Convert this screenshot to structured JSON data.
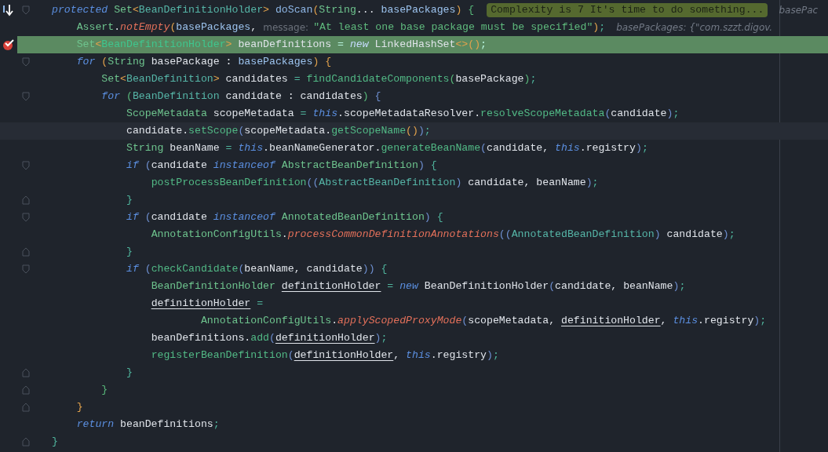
{
  "editor": {
    "lines": [
      {
        "step_marker": true,
        "fold_start": true,
        "segments": [
          {
            "kind": "code",
            "tokens": [
              {
                "text": "protected ",
                "kind": "kw"
              },
              {
                "text": "Set",
                "kind": "type"
              },
              {
                "text": "<",
                "kind": "p1"
              },
              {
                "text": "BeanDefinitionHolder",
                "kind": "gen"
              },
              {
                "text": "> ",
                "kind": "p1"
              },
              {
                "text": "doScan",
                "kind": "decl"
              },
              {
                "text": "(",
                "kind": "p1"
              },
              {
                "text": "String",
                "kind": "type"
              },
              {
                "text": "... ",
                "kind": "id"
              },
              {
                "text": "basePackages",
                "kind": "param"
              },
              {
                "text": ")",
                "kind": "p1"
              },
              {
                "text": " {",
                "kind": "p2"
              }
            ]
          },
          {
            "kind": "badge",
            "text": "Complexity is 7 It's time to do something..."
          },
          {
            "kind": "value_hint",
            "text": "basePac"
          }
        ]
      },
      {
        "segments": [
          {
            "kind": "code",
            "tokens": [
              {
                "text": "    Assert",
                "kind": "type"
              },
              {
                "text": ".",
                "kind": "id"
              },
              {
                "text": "notEmpty",
                "kind": "sfn"
              },
              {
                "text": "(",
                "kind": "p1"
              },
              {
                "text": "basePackages",
                "kind": "param"
              },
              {
                "text": ",",
                "kind": "id"
              }
            ]
          },
          {
            "kind": "param_hint",
            "text": "message:"
          },
          {
            "kind": "code",
            "tokens": [
              {
                "text": "\"At least one base package must be specified\"",
                "kind": "str"
              },
              {
                "text": ")",
                "kind": "p1"
              },
              {
                "text": ";",
                "kind": "op"
              }
            ]
          },
          {
            "kind": "value_hint",
            "text": "basePackages: {\"com.szzt.digov."
          }
        ]
      },
      {
        "execution": true,
        "breakpoint": true,
        "segments": [
          {
            "kind": "code",
            "tokens": [
              {
                "text": "    Set",
                "kind": "type"
              },
              {
                "text": "<",
                "kind": "p1"
              },
              {
                "text": "BeanDefinitionHolder",
                "kind": "gen"
              },
              {
                "text": ">",
                "kind": "p1"
              },
              {
                "text": " beanDefinitions ",
                "kind": "id"
              },
              {
                "text": "= ",
                "kind": "op"
              },
              {
                "text": "new",
                "kind": "kw"
              },
              {
                "text": " LinkedHashSet",
                "kind": "id"
              },
              {
                "text": "<>",
                "kind": "p1"
              },
              {
                "text": "()",
                "kind": "p1"
              },
              {
                "text": ";",
                "kind": "op"
              }
            ]
          }
        ]
      },
      {
        "fold_start": true,
        "segments": [
          {
            "kind": "code",
            "tokens": [
              {
                "text": "    for",
                "kind": "kw"
              },
              {
                "text": " (",
                "kind": "p1"
              },
              {
                "text": "String",
                "kind": "type"
              },
              {
                "text": " basePackage : ",
                "kind": "id"
              },
              {
                "text": "basePackages",
                "kind": "param"
              },
              {
                "text": ")",
                "kind": "p1"
              },
              {
                "text": " {",
                "kind": "p1"
              }
            ]
          }
        ]
      },
      {
        "segments": [
          {
            "kind": "code",
            "tokens": [
              {
                "text": "        Set",
                "kind": "type"
              },
              {
                "text": "<",
                "kind": "p1"
              },
              {
                "text": "BeanDefinition",
                "kind": "gen"
              },
              {
                "text": ">",
                "kind": "p1"
              },
              {
                "text": " candidates ",
                "kind": "id"
              },
              {
                "text": "= ",
                "kind": "op"
              },
              {
                "text": "findCandidateComponents",
                "kind": "fn"
              },
              {
                "text": "(",
                "kind": "p2"
              },
              {
                "text": "basePackage",
                "kind": "id"
              },
              {
                "text": ")",
                "kind": "p2"
              },
              {
                "text": ";",
                "kind": "op"
              }
            ]
          }
        ]
      },
      {
        "fold_start": true,
        "segments": [
          {
            "kind": "code",
            "tokens": [
              {
                "text": "        for",
                "kind": "kw"
              },
              {
                "text": " (",
                "kind": "p2"
              },
              {
                "text": "BeanDefinition",
                "kind": "gen"
              },
              {
                "text": " candidate : candidates",
                "kind": "id"
              },
              {
                "text": ")",
                "kind": "p2"
              },
              {
                "text": " {",
                "kind": "p3"
              }
            ]
          }
        ]
      },
      {
        "segments": [
          {
            "kind": "code",
            "tokens": [
              {
                "text": "            ScopeMetadata",
                "kind": "type"
              },
              {
                "text": " scopeMetadata ",
                "kind": "id"
              },
              {
                "text": "= ",
                "kind": "op"
              },
              {
                "text": "this",
                "kind": "kw"
              },
              {
                "text": ".scopeMetadataResolver.",
                "kind": "id"
              },
              {
                "text": "resolveScopeMetadata",
                "kind": "fn"
              },
              {
                "text": "(",
                "kind": "p3"
              },
              {
                "text": "candidate",
                "kind": "id"
              },
              {
                "text": ")",
                "kind": "p3"
              },
              {
                "text": ";",
                "kind": "op"
              }
            ]
          }
        ]
      },
      {
        "caret": true,
        "segments": [
          {
            "kind": "code",
            "tokens": [
              {
                "text": "            candidate.",
                "kind": "id"
              },
              {
                "text": "setScope",
                "kind": "fn"
              },
              {
                "text": "(",
                "kind": "p3"
              },
              {
                "text": "scopeMetadata.",
                "kind": "id"
              },
              {
                "text": "getScopeName",
                "kind": "fn"
              },
              {
                "text": "()",
                "kind": "p1"
              },
              {
                "text": ")",
                "kind": "p3"
              },
              {
                "text": ";",
                "kind": "op"
              }
            ]
          }
        ]
      },
      {
        "segments": [
          {
            "kind": "code",
            "tokens": [
              {
                "text": "            String",
                "kind": "type"
              },
              {
                "text": " beanName ",
                "kind": "id"
              },
              {
                "text": "= ",
                "kind": "op"
              },
              {
                "text": "this",
                "kind": "kw"
              },
              {
                "text": ".beanNameGenerator.",
                "kind": "id"
              },
              {
                "text": "generateBeanName",
                "kind": "fn"
              },
              {
                "text": "(",
                "kind": "p3"
              },
              {
                "text": "candidate, ",
                "kind": "id"
              },
              {
                "text": "this",
                "kind": "kw"
              },
              {
                "text": ".registry",
                "kind": "id"
              },
              {
                "text": ")",
                "kind": "p3"
              },
              {
                "text": ";",
                "kind": "op"
              }
            ]
          }
        ]
      },
      {
        "fold_start": true,
        "segments": [
          {
            "kind": "code",
            "tokens": [
              {
                "text": "            if",
                "kind": "kw"
              },
              {
                "text": " (",
                "kind": "p3"
              },
              {
                "text": "candidate ",
                "kind": "id"
              },
              {
                "text": "instanceof",
                "kind": "kw"
              },
              {
                "text": " AbstractBeanDefinition",
                "kind": "type"
              },
              {
                "text": ")",
                "kind": "p3"
              },
              {
                "text": " {",
                "kind": "op"
              }
            ]
          }
        ]
      },
      {
        "segments": [
          {
            "kind": "code",
            "tokens": [
              {
                "text": "                postProcessBeanDefinition",
                "kind": "fn"
              },
              {
                "text": "((",
                "kind": "p3"
              },
              {
                "text": "AbstractBeanDefinition",
                "kind": "gen"
              },
              {
                "text": ")",
                "kind": "p3"
              },
              {
                "text": " candidate, beanName",
                "kind": "id"
              },
              {
                "text": ")",
                "kind": "p3"
              },
              {
                "text": ";",
                "kind": "op"
              }
            ]
          }
        ]
      },
      {
        "fold_end": true,
        "segments": [
          {
            "kind": "code",
            "tokens": [
              {
                "text": "            }",
                "kind": "op"
              }
            ]
          }
        ]
      },
      {
        "fold_start": true,
        "segments": [
          {
            "kind": "code",
            "tokens": [
              {
                "text": "            if",
                "kind": "kw"
              },
              {
                "text": " (",
                "kind": "p3"
              },
              {
                "text": "candidate ",
                "kind": "id"
              },
              {
                "text": "instanceof",
                "kind": "kw"
              },
              {
                "text": " AnnotatedBeanDefinition",
                "kind": "type"
              },
              {
                "text": ")",
                "kind": "p3"
              },
              {
                "text": " {",
                "kind": "op"
              }
            ]
          }
        ]
      },
      {
        "segments": [
          {
            "kind": "code",
            "tokens": [
              {
                "text": "                AnnotationConfigUtils",
                "kind": "type"
              },
              {
                "text": ".",
                "kind": "id"
              },
              {
                "text": "processCommonDefinitionAnnotations",
                "kind": "sfn"
              },
              {
                "text": "((",
                "kind": "p3"
              },
              {
                "text": "AnnotatedBeanDefinition",
                "kind": "gen"
              },
              {
                "text": ")",
                "kind": "p3"
              },
              {
                "text": " candidate",
                "kind": "id"
              },
              {
                "text": ")",
                "kind": "p3"
              },
              {
                "text": ";",
                "kind": "op"
              }
            ]
          }
        ]
      },
      {
        "fold_end": true,
        "segments": [
          {
            "kind": "code",
            "tokens": [
              {
                "text": "            }",
                "kind": "op"
              }
            ]
          }
        ]
      },
      {
        "fold_start": true,
        "segments": [
          {
            "kind": "code",
            "tokens": [
              {
                "text": "            if",
                "kind": "kw"
              },
              {
                "text": " (",
                "kind": "p3"
              },
              {
                "text": "checkCandidate",
                "kind": "fn"
              },
              {
                "text": "(",
                "kind": "p3"
              },
              {
                "text": "beanName, candidate",
                "kind": "id"
              },
              {
                "text": "))",
                "kind": "p3"
              },
              {
                "text": " {",
                "kind": "op"
              }
            ]
          }
        ]
      },
      {
        "segments": [
          {
            "kind": "code",
            "tokens": [
              {
                "text": "                BeanDefinitionHolder ",
                "kind": "type"
              },
              {
                "text": "definitionHolder",
                "kind": "var"
              },
              {
                "text": " = ",
                "kind": "op"
              },
              {
                "text": "new",
                "kind": "kw"
              },
              {
                "text": " BeanDefinitionHolder",
                "kind": "id"
              },
              {
                "text": "(",
                "kind": "p3"
              },
              {
                "text": "candidate, beanName",
                "kind": "id"
              },
              {
                "text": ")",
                "kind": "p3"
              },
              {
                "text": ";",
                "kind": "op"
              }
            ]
          }
        ]
      },
      {
        "segments": [
          {
            "kind": "code",
            "tokens": [
              {
                "text": "                definitionHolder",
                "kind": "var"
              },
              {
                "text": " =",
                "kind": "op"
              }
            ]
          }
        ]
      },
      {
        "segments": [
          {
            "kind": "code",
            "tokens": [
              {
                "text": "                        AnnotationConfigUtils",
                "kind": "type"
              },
              {
                "text": ".",
                "kind": "id"
              },
              {
                "text": "applyScopedProxyMode",
                "kind": "sfn"
              },
              {
                "text": "(",
                "kind": "p3"
              },
              {
                "text": "scopeMetadata, ",
                "kind": "id"
              },
              {
                "text": "definitionHolder",
                "kind": "var"
              },
              {
                "text": ", ",
                "kind": "id"
              },
              {
                "text": "this",
                "kind": "kw"
              },
              {
                "text": ".registry",
                "kind": "id"
              },
              {
                "text": ")",
                "kind": "p3"
              },
              {
                "text": ";",
                "kind": "op"
              }
            ]
          }
        ]
      },
      {
        "segments": [
          {
            "kind": "code",
            "tokens": [
              {
                "text": "                beanDefinitions.",
                "kind": "id"
              },
              {
                "text": "add",
                "kind": "fn"
              },
              {
                "text": "(",
                "kind": "p3"
              },
              {
                "text": "definitionHolder",
                "kind": "var"
              },
              {
                "text": ")",
                "kind": "p3"
              },
              {
                "text": ";",
                "kind": "op"
              }
            ]
          }
        ]
      },
      {
        "segments": [
          {
            "kind": "code",
            "tokens": [
              {
                "text": "                registerBeanDefinition",
                "kind": "fn"
              },
              {
                "text": "(",
                "kind": "p3"
              },
              {
                "text": "definitionHolder",
                "kind": "var"
              },
              {
                "text": ", ",
                "kind": "id"
              },
              {
                "text": "this",
                "kind": "kw"
              },
              {
                "text": ".registry",
                "kind": "id"
              },
              {
                "text": ")",
                "kind": "p3"
              },
              {
                "text": ";",
                "kind": "op"
              }
            ]
          }
        ]
      },
      {
        "fold_end": true,
        "segments": [
          {
            "kind": "code",
            "tokens": [
              {
                "text": "            }",
                "kind": "op"
              }
            ]
          }
        ]
      },
      {
        "fold_end": true,
        "segments": [
          {
            "kind": "code",
            "tokens": [
              {
                "text": "        }",
                "kind": "p2"
              }
            ]
          }
        ]
      },
      {
        "fold_end": true,
        "segments": [
          {
            "kind": "code",
            "tokens": [
              {
                "text": "    }",
                "kind": "p1"
              }
            ]
          }
        ]
      },
      {
        "segments": [
          {
            "kind": "code",
            "tokens": [
              {
                "text": "    return",
                "kind": "kw"
              },
              {
                "text": " beanDefinitions",
                "kind": "id"
              },
              {
                "text": ";",
                "kind": "op"
              }
            ]
          }
        ]
      },
      {
        "fold_end": true,
        "segments": [
          {
            "kind": "code",
            "tokens": [
              {
                "text": "}",
                "kind": "op"
              }
            ]
          }
        ]
      }
    ]
  }
}
